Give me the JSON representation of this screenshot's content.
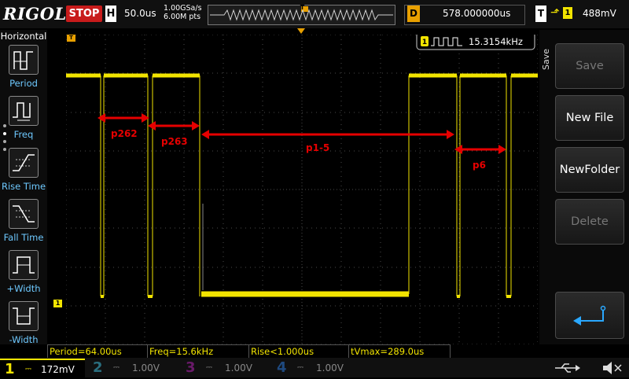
{
  "header": {
    "logo": "RIGOL",
    "run_state": "STOP",
    "timebase_label": "H",
    "timebase_value": "50.0us",
    "sample_rate": "1.00GSa/s",
    "memory_depth": "6.00M pts",
    "trigger_marker": "T",
    "delay_label": "D",
    "delay_value": "578.000000us",
    "trigger_label": "T",
    "trigger_channel": "1",
    "trigger_level": "488mV"
  },
  "left_menu": {
    "title": "Horizontal",
    "items": [
      {
        "label": "Period",
        "icon": "period-icon"
      },
      {
        "label": "Freq",
        "icon": "frequency-icon"
      },
      {
        "label": "Rise Time",
        "icon": "rise-time-icon"
      },
      {
        "label": "Fall Time",
        "icon": "fall-time-icon"
      },
      {
        "label": "+Width",
        "icon": "positive-width-icon"
      },
      {
        "label": "-Width",
        "icon": "negative-width-icon"
      }
    ]
  },
  "right_menu": {
    "tab": "Save",
    "buttons": [
      {
        "label": "Save",
        "enabled": false
      },
      {
        "label": "New File",
        "enabled": true
      },
      {
        "label": "NewFolder",
        "enabled": true
      },
      {
        "label": "Delete",
        "enabled": false
      }
    ],
    "enter_icon": "enter-arrow-icon"
  },
  "frequency_counter": {
    "channel": "1",
    "value": "15.3154kHz"
  },
  "markers": {
    "trace_channel": "1",
    "trigger_offset": "T"
  },
  "annotations": [
    "p262",
    "p263",
    "p1-5",
    "p6"
  ],
  "measurements": [
    "Period=64.00us",
    "Freq=15.6kHz",
    "Rise<1.000us",
    "tVmax=289.0us"
  ],
  "channels": [
    {
      "num": "1",
      "scale": "172mV",
      "active": true,
      "color": "#f2e400"
    },
    {
      "num": "2",
      "scale": "1.00V",
      "active": false,
      "color": "#00a8d8"
    },
    {
      "num": "3",
      "scale": "1.00V",
      "active": false,
      "color": "#c000c0"
    },
    {
      "num": "4",
      "scale": "1.00V",
      "active": false,
      "color": "#1a6fd0"
    }
  ],
  "colors": {
    "ch1": "#f2e400",
    "annotation": "#e60000",
    "stop": "#c81b1b",
    "delay": "#e8a000",
    "label_blue": "#6ec9ff"
  }
}
